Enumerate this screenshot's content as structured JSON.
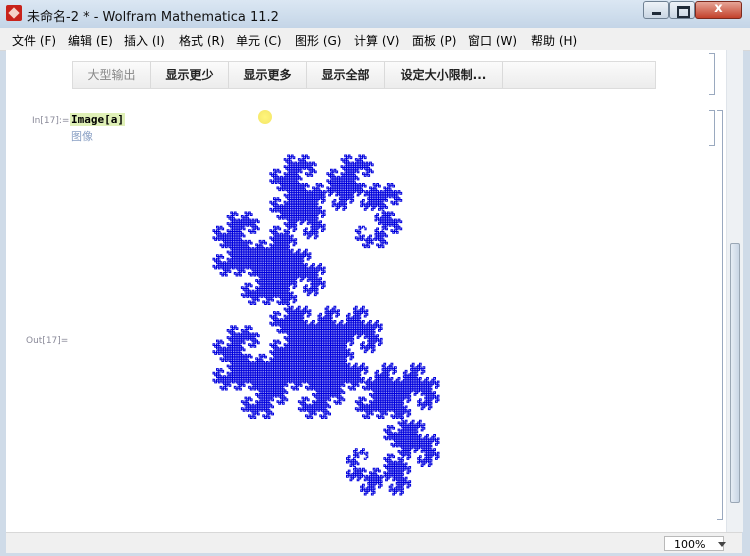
{
  "window": {
    "title": "未命名-2 * - Wolfram Mathematica 11.2",
    "close_label": "x"
  },
  "menu": [
    "文件 (F)",
    "编辑 (E)",
    "插入 (I)",
    "格式 (R)",
    "单元 (C)",
    "图形 (G)",
    "计算 (V)",
    "面板 (P)",
    "窗口 (W)",
    "帮助 (H)"
  ],
  "output_toolbar": [
    "大型输出",
    "显示更少",
    "显示更多",
    "显示全部",
    "设定大小限制..."
  ],
  "input_cell": {
    "label": "In[17]:=",
    "code": "Image[a]",
    "hint": "图像"
  },
  "output_cell": {
    "label": "Out[17]=",
    "image": "dragon-curve-fractal",
    "color": "#0000dd"
  },
  "status": {
    "zoom": "100%"
  },
  "colors": {
    "fractal": "#0000dd",
    "input_highlight": "#dff0b6"
  }
}
